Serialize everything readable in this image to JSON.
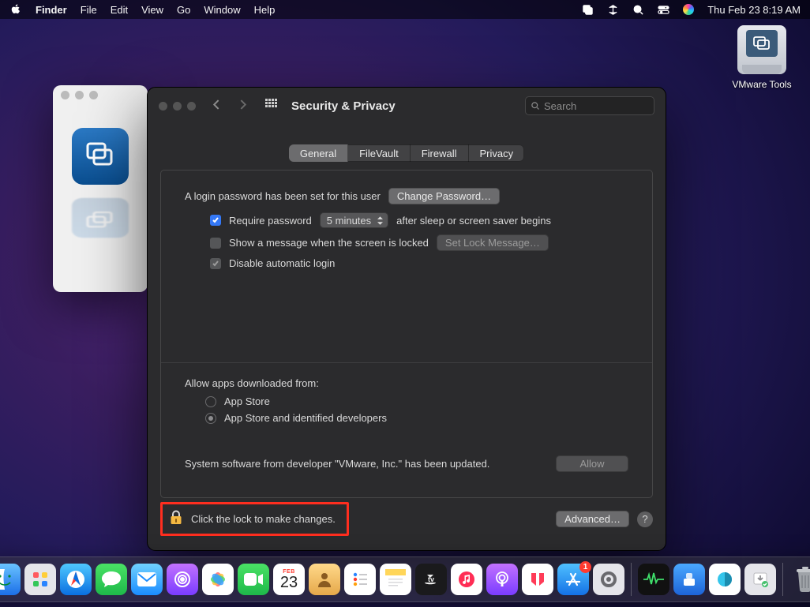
{
  "menubar": {
    "app": "Finder",
    "items": [
      "File",
      "Edit",
      "View",
      "Go",
      "Window",
      "Help"
    ],
    "datetime": "Thu Feb 23  8:19 AM"
  },
  "desktop": {
    "vmware_tools_label": "VMware Tools"
  },
  "syspref": {
    "title": "Security & Privacy",
    "search_placeholder": "Search",
    "tabs": {
      "general": "General",
      "filevault": "FileVault",
      "firewall": "Firewall",
      "privacy": "Privacy"
    },
    "login_text": "A login password has been set for this user",
    "change_password": "Change Password…",
    "require_password": "Require password",
    "require_password_delay": "5 minutes",
    "require_password_suffix": "after sleep or screen saver begins",
    "show_message": "Show a message when the screen is locked",
    "set_lock_message": "Set Lock Message…",
    "disable_auto_login": "Disable automatic login",
    "allow_apps_header": "Allow apps downloaded from:",
    "app_store": "App Store",
    "app_store_identified": "App Store and identified developers",
    "system_software_text": "System software from developer \"VMware, Inc.\" has been updated.",
    "allow_btn": "Allow",
    "lock_hint": "Click the lock to make changes.",
    "advanced_btn": "Advanced…",
    "help_q": "?"
  },
  "dock": {
    "badge_count": "1",
    "calendar_month": "FEB",
    "calendar_day": "23"
  }
}
